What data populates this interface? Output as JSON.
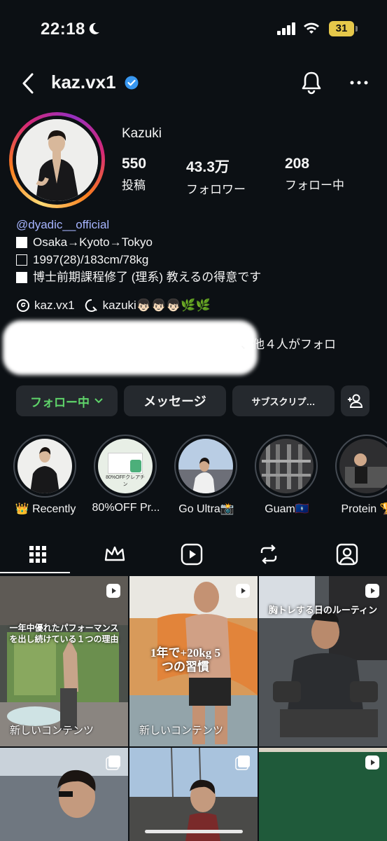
{
  "status_bar": {
    "time": "22:18",
    "battery": "31"
  },
  "nav": {
    "username": "kaz.vx1"
  },
  "profile": {
    "display_name": "Kazuki",
    "stats": [
      {
        "value": "550",
        "label": "投稿"
      },
      {
        "value": "43.3万",
        "label": "フォロワー"
      },
      {
        "value": "208",
        "label": "フォロー中"
      }
    ]
  },
  "bio": {
    "mention": "@dyadic__official",
    "line1": "Osaka→Kyoto→Tokyo",
    "line2": "1997(28)/183cm/78kg",
    "line3": "博士前期課程修了 (理系) 教えるの得意です"
  },
  "links": {
    "threads": "kaz.vx1",
    "other": "kazuki👦🏻👦🏻👦🏻🌿🌿"
  },
  "followed_by": "、他４人がフォロ",
  "buttons": {
    "follow": "フォロー中",
    "message": "メッセージ",
    "subscribe": "サブスクリプ…"
  },
  "highlights": [
    {
      "label": "Recently",
      "prefix": "👑"
    },
    {
      "label": "80%OFF Pr..."
    },
    {
      "label": "Go Ultra📸"
    },
    {
      "label": "Guam🇬🇺"
    },
    {
      "label": "Protein 🏆"
    }
  ],
  "posts": {
    "p1_overlay": "一年中優れたパフォーマンスを出し続けている１つの理由",
    "p1_caption": "新しいコンテンツ",
    "p2_overlay": "1年で+20kg 5つの習慣",
    "p2_caption": "新しいコンテンツ",
    "p3_overlay": "胸トレする日のルーティン",
    "hl2_card": "80%OFFクレアチン"
  },
  "colors": {
    "accent_green": "#5fd36a",
    "link_blue": "#a6b4ff",
    "bg": "#0c1014",
    "button_bg": "#25292e",
    "verified": "#3897f0"
  }
}
